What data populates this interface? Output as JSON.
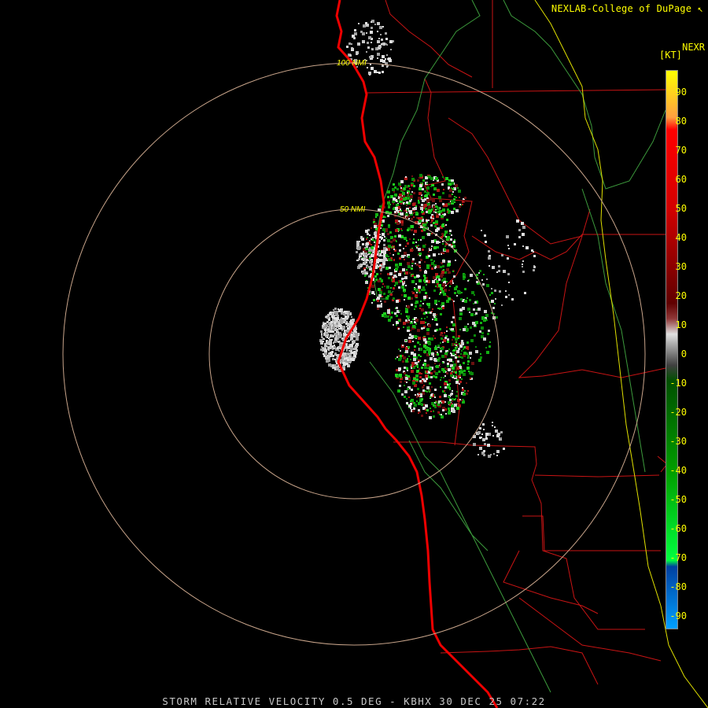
{
  "header": {
    "credit": "NEXLAB-College of DuPage"
  },
  "footer": {
    "caption": "STORM RELATIVE VELOCITY 0.5 DEG - KBHX 30 DEC 25 07:22"
  },
  "legend": {
    "product": "NEXR",
    "unit": "[KT]",
    "ticks": [
      "90",
      "80",
      "70",
      "60",
      "50",
      "40",
      "30",
      "20",
      "10",
      "0",
      "-10",
      "-20",
      "-30",
      "-40",
      "-50",
      "-60",
      "-70",
      "-80",
      "-90"
    ]
  },
  "rings": [
    {
      "label": "50 NMI",
      "range_nmi": 50
    },
    {
      "label": "100 NMI",
      "range_nmi": 100
    }
  ],
  "colors": {
    "rings": "#c8a48a",
    "ring_label": "#ffff00",
    "coastline": "#ee0000",
    "county_lines": "#d01010",
    "state_lines": "#e8e800",
    "rivers": "#3c9a3c",
    "echo_gray": "#c8c8c8",
    "echo_green": "#12b012",
    "echo_red": "#b01818"
  },
  "colorbar_stops": [
    {
      "kt": 90,
      "color": "#ffff00"
    },
    {
      "kt": 75,
      "color": "#ffa040"
    },
    {
      "kt": 71,
      "color": "#ff0000"
    },
    {
      "kt": 45,
      "color": "#d00000"
    },
    {
      "kt": 15,
      "color": "#600000"
    },
    {
      "kt": 10,
      "color": "#903838"
    },
    {
      "kt": 5,
      "color": "#e0e0e0"
    },
    {
      "kt": 0,
      "color": "#909090"
    },
    {
      "kt": -5,
      "color": "#404040"
    },
    {
      "kt": -10,
      "color": "#005000"
    },
    {
      "kt": -40,
      "color": "#00a000"
    },
    {
      "kt": -68,
      "color": "#00ff40"
    },
    {
      "kt": -70,
      "color": "#0040a0"
    },
    {
      "kt": -90,
      "color": "#00a0ff"
    }
  ]
}
